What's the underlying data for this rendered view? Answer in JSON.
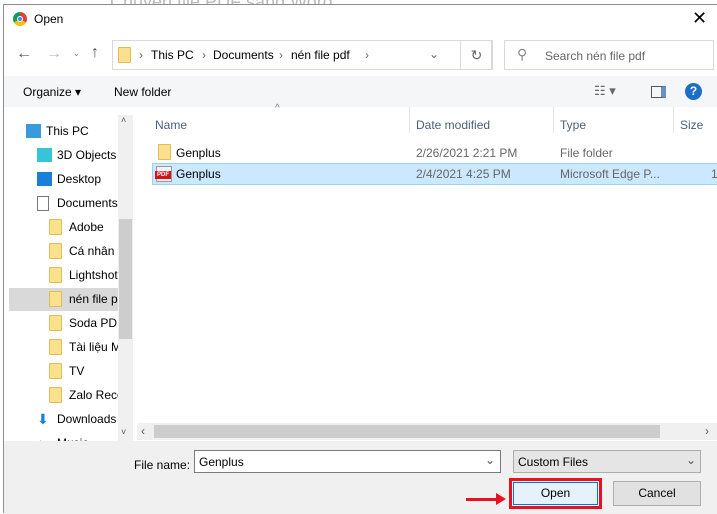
{
  "background_text": "Chuyển file PDF sang Word",
  "title": "Open",
  "address": {
    "crumbs": [
      "This PC",
      "Documents",
      "nén file pdf"
    ]
  },
  "search": {
    "placeholder": "Search nén file pdf"
  },
  "toolbar": {
    "organize": "Organize",
    "new_folder": "New folder"
  },
  "nav": {
    "items": [
      {
        "label": "This PC",
        "icon": "computer-icon"
      },
      {
        "label": "3D Objects",
        "icon": "cube-icon"
      },
      {
        "label": "Desktop",
        "icon": "desktop-icon"
      },
      {
        "label": "Documents",
        "icon": "document-icon"
      },
      {
        "label": "Adobe",
        "icon": "folder-icon"
      },
      {
        "label": "Cá nhân",
        "icon": "folder-icon"
      },
      {
        "label": "Lightshot",
        "icon": "folder-icon"
      },
      {
        "label": "nén file pdf",
        "icon": "folder-icon",
        "selected": true
      },
      {
        "label": "Soda PDF",
        "icon": "folder-icon"
      },
      {
        "label": "Tài liệu M",
        "icon": "folder-icon"
      },
      {
        "label": "TV",
        "icon": "folder-icon"
      },
      {
        "label": "Zalo Rece",
        "icon": "folder-icon"
      },
      {
        "label": "Downloads",
        "icon": "download-icon"
      },
      {
        "label": "Music",
        "icon": "music-icon"
      }
    ]
  },
  "columns": [
    "Name",
    "Date modified",
    "Type",
    "Size"
  ],
  "files": [
    {
      "name": "Genplus",
      "date": "2/26/2021 2:21 PM",
      "type": "File folder",
      "size": "",
      "icon": "folder-icon"
    },
    {
      "name": "Genplus",
      "date": "2/4/2021 4:25 PM",
      "type": "Microsoft Edge P...",
      "size": "1",
      "icon": "pdf-icon",
      "selected": true
    }
  ],
  "pdf_badge": "PDF",
  "bottom": {
    "file_name_label": "File name:",
    "file_name_value": "Genplus",
    "filter": "Custom Files",
    "open": "Open",
    "cancel": "Cancel"
  },
  "colors": {
    "selection": "#cce8ff",
    "highlight": "#e81123",
    "accent": "#0078d7"
  }
}
